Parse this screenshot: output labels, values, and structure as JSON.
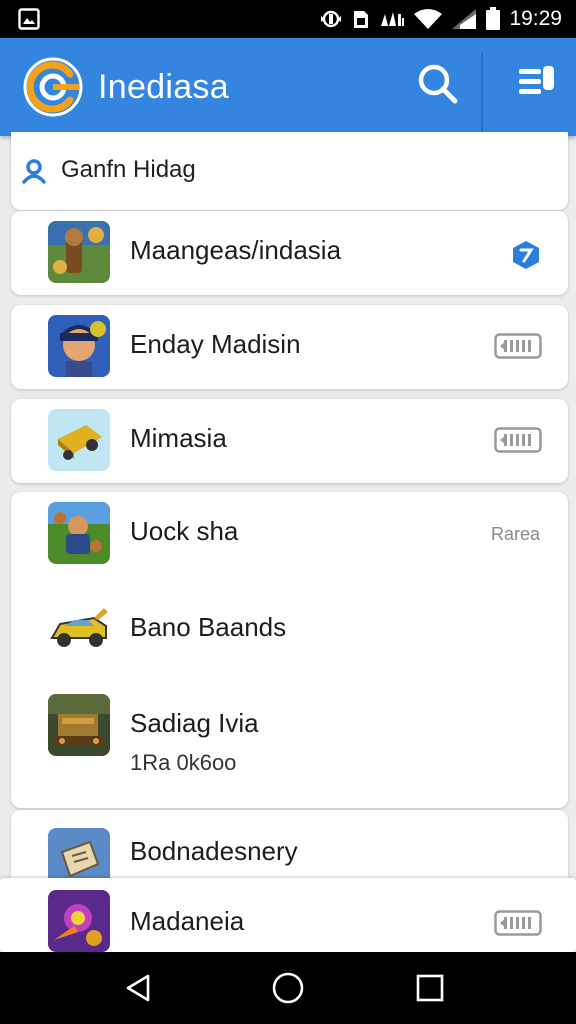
{
  "status_bar": {
    "time": "19:29",
    "icons": [
      "gallery-icon",
      "sync-icon",
      "sim-icon",
      "signal-bars-icon",
      "wifi-icon",
      "cellular-icon",
      "battery-icon"
    ]
  },
  "app_bar": {
    "title": "Inediasa",
    "icons": [
      "app-logo-icon",
      "search-icon",
      "menu-icon"
    ],
    "color": "#3385e0"
  },
  "search": {
    "text": "Ganfn Hidag",
    "icon": "person-icon"
  },
  "items": [
    {
      "label": "Maangeas/indasia",
      "icon": "game-icon-fighter",
      "badge": "navigation-badge-icon"
    },
    {
      "label": "Enday Madisin",
      "icon": "game-icon-hero",
      "badge": "storage-chip-icon"
    },
    {
      "label": "Mimasia",
      "icon": "game-icon-cart",
      "badge": "storage-chip-icon"
    }
  ],
  "group": [
    {
      "label": "Uock sha",
      "icon": "game-icon-warrior",
      "right_text": "Rarea"
    },
    {
      "label": "Bano Baands",
      "icon": "game-icon-car"
    },
    {
      "label": "Sadiag Ivia",
      "icon": "game-icon-tank",
      "sub": "1Ra 0k6oo"
    }
  ],
  "bottom_items": [
    {
      "label": "Bodnadesnery",
      "icon": "game-icon-map"
    },
    {
      "label": "Madaneia",
      "icon": "game-icon-magic",
      "badge": "storage-chip-icon"
    }
  ],
  "nav_bar": {
    "icons": [
      "back-icon",
      "home-icon",
      "recents-icon"
    ]
  },
  "colors": {
    "accent": "#3385e0",
    "badge_blue": "#2b7ee0",
    "background": "#ececec"
  }
}
